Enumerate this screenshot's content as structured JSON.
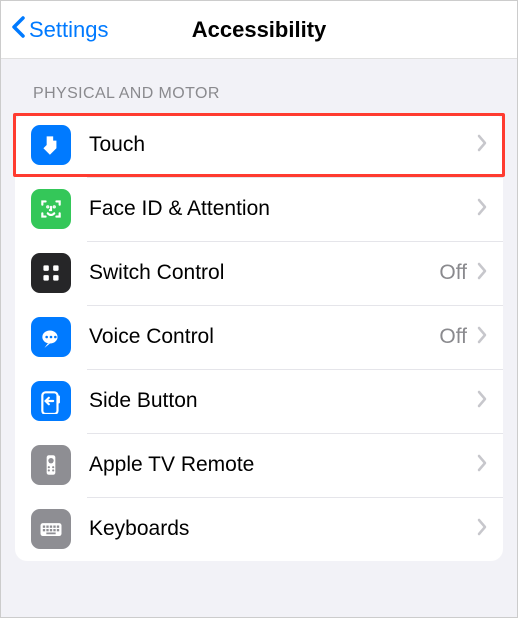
{
  "nav": {
    "back_label": "Settings",
    "title": "Accessibility"
  },
  "section": {
    "header": "PHYSICAL AND MOTOR",
    "rows": [
      {
        "label": "Touch",
        "value": "",
        "highlighted": true
      },
      {
        "label": "Face ID & Attention",
        "value": ""
      },
      {
        "label": "Switch Control",
        "value": "Off"
      },
      {
        "label": "Voice Control",
        "value": "Off"
      },
      {
        "label": "Side Button",
        "value": ""
      },
      {
        "label": "Apple TV Remote",
        "value": ""
      },
      {
        "label": "Keyboards",
        "value": ""
      }
    ]
  },
  "colors": {
    "accent": "#007aff",
    "highlight_border": "#ff3b30"
  }
}
